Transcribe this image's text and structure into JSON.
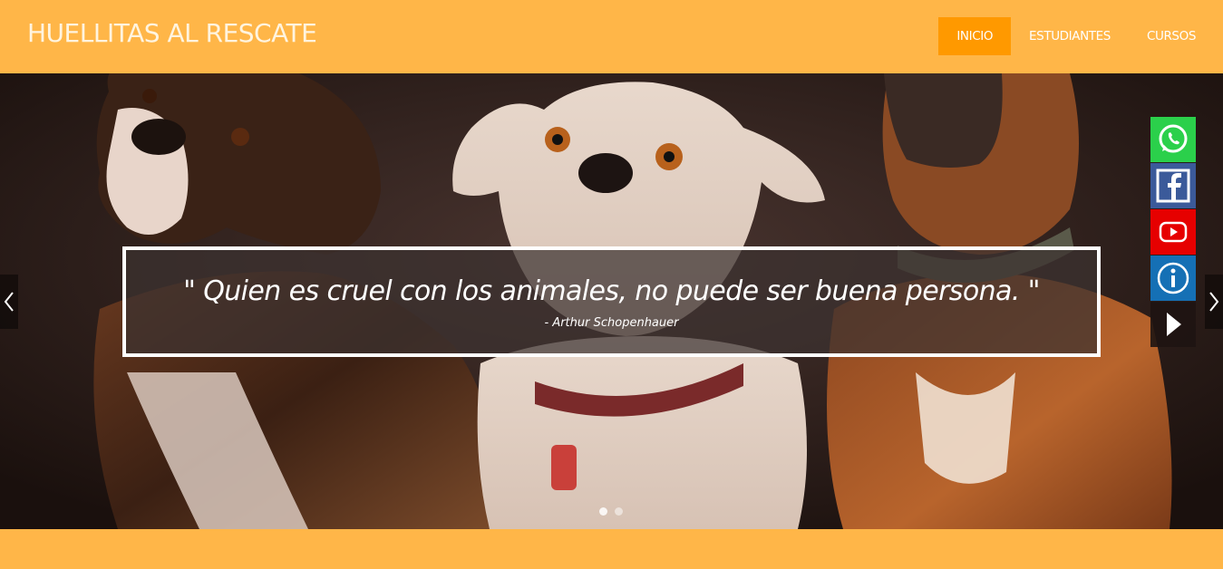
{
  "brand": {
    "title": "HUELLITAS AL RESCATE"
  },
  "nav": {
    "items": [
      {
        "label": "INICIO",
        "active": true
      },
      {
        "label": "ESTUDIANTES",
        "active": false
      },
      {
        "label": "CURSOS",
        "active": false
      }
    ]
  },
  "hero": {
    "quote": "\" Quien es cruel con los animales, no puede ser buena persona. \"",
    "author": "- Arthur Schopenhauer",
    "slides_count": 2,
    "active_slide": 1
  },
  "social": {
    "items": [
      {
        "name": "whatsapp-icon",
        "color": "#2bd04b"
      },
      {
        "name": "facebook-icon",
        "color": "#3b5a9a"
      },
      {
        "name": "youtube-icon",
        "color": "#e60000"
      },
      {
        "name": "info-icon",
        "color": "#1570b5"
      },
      {
        "name": "play-icon",
        "color": "#1e1412"
      }
    ]
  },
  "colors": {
    "navbar": "#ffb648",
    "nav_active": "#ff9900"
  }
}
